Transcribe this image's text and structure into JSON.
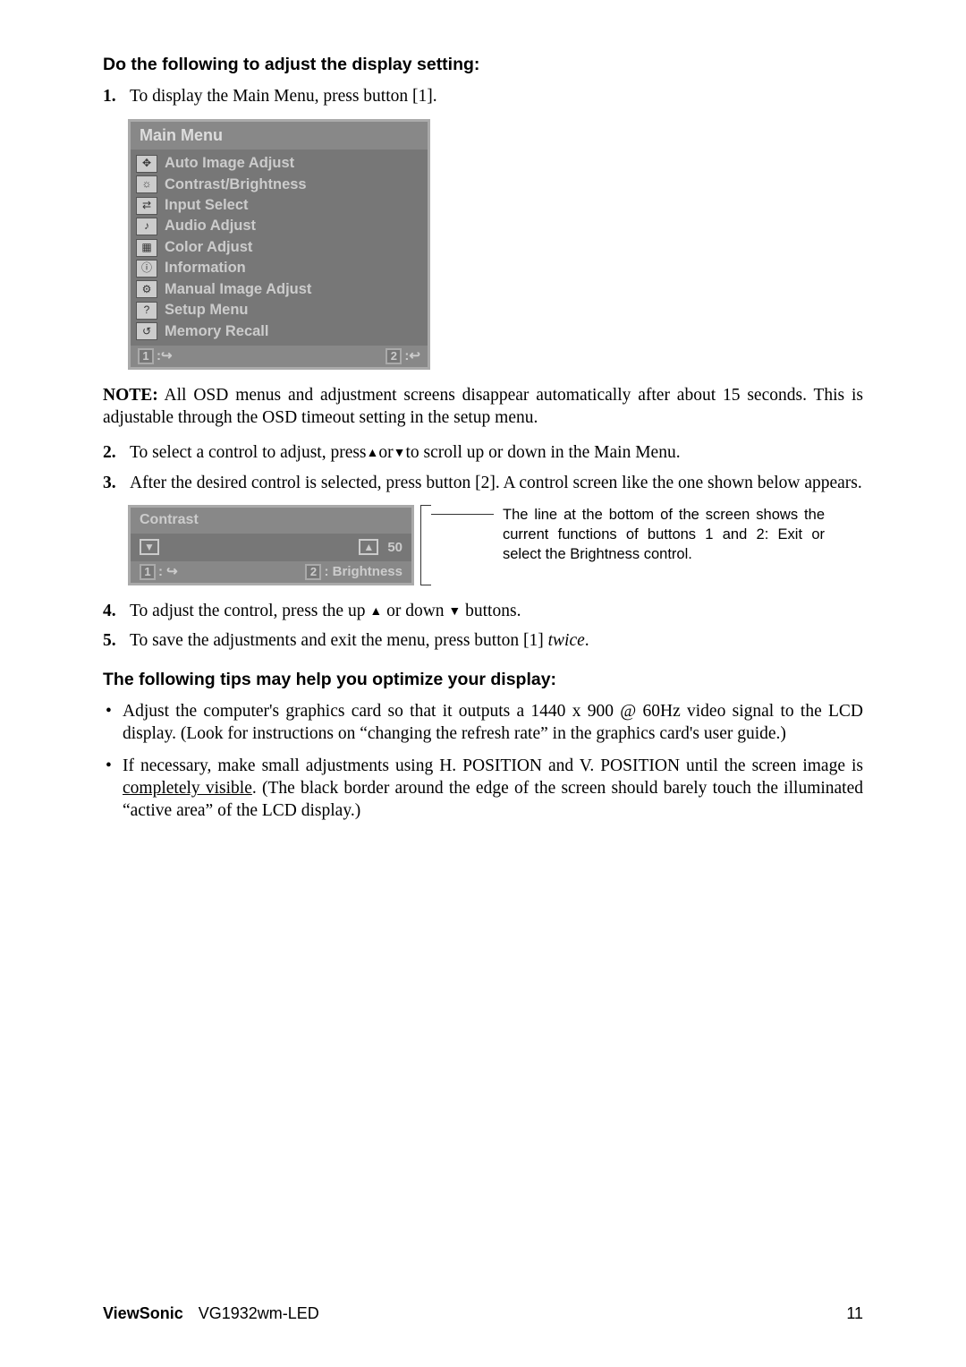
{
  "headings": {
    "h1": "Do the following to adjust the display setting:",
    "h2": "The following tips may help you optimize your display:"
  },
  "steps": {
    "s1_num": "1.",
    "s1_txt": "To display the Main Menu, press button [1].",
    "s2_num": "2.",
    "s2_txt_a": "To select a control to adjust, press",
    "s2_txt_b": "or",
    "s2_txt_c": "to scroll up or down in the Main Menu.",
    "s3_num": "3.",
    "s3_txt": "After the desired control is selected, press button [2]. A control screen like the one shown below appears.",
    "s4_num": "4.",
    "s4_txt_a": "To adjust the control, press the up ",
    "s4_txt_b": " or down ",
    "s4_txt_c": " buttons.",
    "s5_num": "5.",
    "s5_txt_a": "To save the adjustments and exit the menu, press button [1] ",
    "s5_twice": "twice",
    "s5_txt_b": "."
  },
  "note": {
    "label": "NOTE:",
    "text": " All OSD menus and adjustment screens disappear automatically after about 15 seconds. This is adjustable through the OSD timeout setting in the setup menu."
  },
  "osd_main": {
    "title": "Main Menu",
    "items": [
      "Auto Image Adjust",
      "Contrast/Brightness",
      "Input Select",
      "Audio Adjust",
      "Color Adjust",
      "Information",
      "Manual Image Adjust",
      "Setup Menu",
      "Memory Recall"
    ],
    "foot1": "1",
    "foot2": "2"
  },
  "contrast_box": {
    "title": "Contrast",
    "value": "50",
    "foot_left_key": "1",
    "foot_right_key": "2",
    "foot_right_label": ": Brightness"
  },
  "callout": "The line at the bottom of the screen shows the current functions of buttons 1 and 2: Exit or select the Brightness control.",
  "tips": {
    "b1": "Adjust the computer's graphics card so that it outputs a 1440 x 900 @ 60Hz video signal to the LCD display. (Look for instructions on “changing the refresh rate” in the graphics card's user guide.)",
    "b2_a": "If necessary, make small adjustments using H. POSITION and V. POSITION until the screen image is ",
    "b2_underline": "completely visible",
    "b2_b": ". (The black border around the edge of the screen should barely touch the illuminated “active area” of the LCD display.)"
  },
  "footer": {
    "brand": "ViewSonic",
    "model": "VG1932wm-LED",
    "page": "11"
  },
  "icons": {
    "up": "▲",
    "down": "▼",
    "exit": "↪",
    "enter": "↩"
  },
  "osd_icon_glyphs": [
    "✥",
    "☼",
    "⇄",
    "♪",
    "▦",
    "ⓘ",
    "⚙",
    "?",
    "↺"
  ]
}
